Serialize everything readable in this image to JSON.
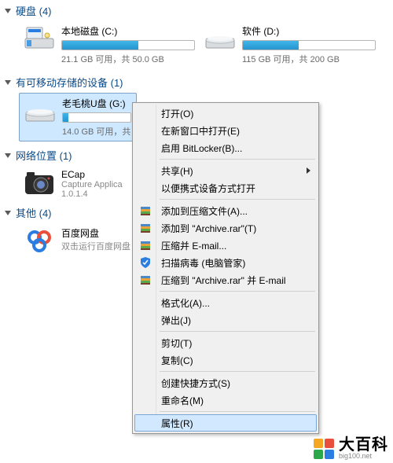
{
  "sections": {
    "hdd": {
      "title": "硬盘 (4)"
    },
    "removable": {
      "title": "有可移动存储的设备 (1)"
    },
    "network": {
      "title": "网络位置 (1)"
    },
    "other": {
      "title": "其他 (4)"
    }
  },
  "drives": {
    "c": {
      "name": "本地磁盘 (C:)",
      "stats": "21.1 GB 可用，共 50.0 GB",
      "fill_pct": 58
    },
    "d": {
      "name": "软件 (D:)",
      "stats": "115 GB 可用，共 200 GB",
      "fill_pct": 42
    },
    "g": {
      "name": "老毛桃U盘 (G:)",
      "stats": "14.0 GB 可用，共",
      "fill_pct": 8
    }
  },
  "apps": {
    "ecap": {
      "name": "ECap",
      "sub1": "Capture Applica",
      "sub2": "1.0.1.4"
    },
    "baidu": {
      "name": "百度网盘",
      "sub1": "双击运行百度网盘"
    }
  },
  "context_menu": [
    {
      "type": "item",
      "label": "打开(O)"
    },
    {
      "type": "item",
      "label": "在新窗口中打开(E)"
    },
    {
      "type": "item",
      "label": "启用 BitLocker(B)..."
    },
    {
      "type": "sep"
    },
    {
      "type": "item",
      "label": "共享(H)",
      "submenu": true
    },
    {
      "type": "item",
      "label": "以便携式设备方式打开"
    },
    {
      "type": "sep"
    },
    {
      "type": "item",
      "label": "添加到压缩文件(A)...",
      "icon": "rar"
    },
    {
      "type": "item",
      "label": "添加到 \"Archive.rar\"(T)",
      "icon": "rar"
    },
    {
      "type": "item",
      "label": "压缩并 E-mail...",
      "icon": "rar"
    },
    {
      "type": "item",
      "label": "扫描病毒 (电脑管家)",
      "icon": "shield"
    },
    {
      "type": "item",
      "label": "压缩到 \"Archive.rar\" 并 E-mail",
      "icon": "rar"
    },
    {
      "type": "sep"
    },
    {
      "type": "item",
      "label": "格式化(A)..."
    },
    {
      "type": "item",
      "label": "弹出(J)"
    },
    {
      "type": "sep"
    },
    {
      "type": "item",
      "label": "剪切(T)"
    },
    {
      "type": "item",
      "label": "复制(C)"
    },
    {
      "type": "sep"
    },
    {
      "type": "item",
      "label": "创建快捷方式(S)"
    },
    {
      "type": "item",
      "label": "重命名(M)"
    },
    {
      "type": "sep"
    },
    {
      "type": "item",
      "label": "属性(R)",
      "hover": true
    }
  ],
  "watermark": {
    "text": "大百科",
    "sub": "big100.net",
    "colors": [
      "#f5a623",
      "#e94f3d",
      "#2aa84a",
      "#2b7de1"
    ]
  }
}
